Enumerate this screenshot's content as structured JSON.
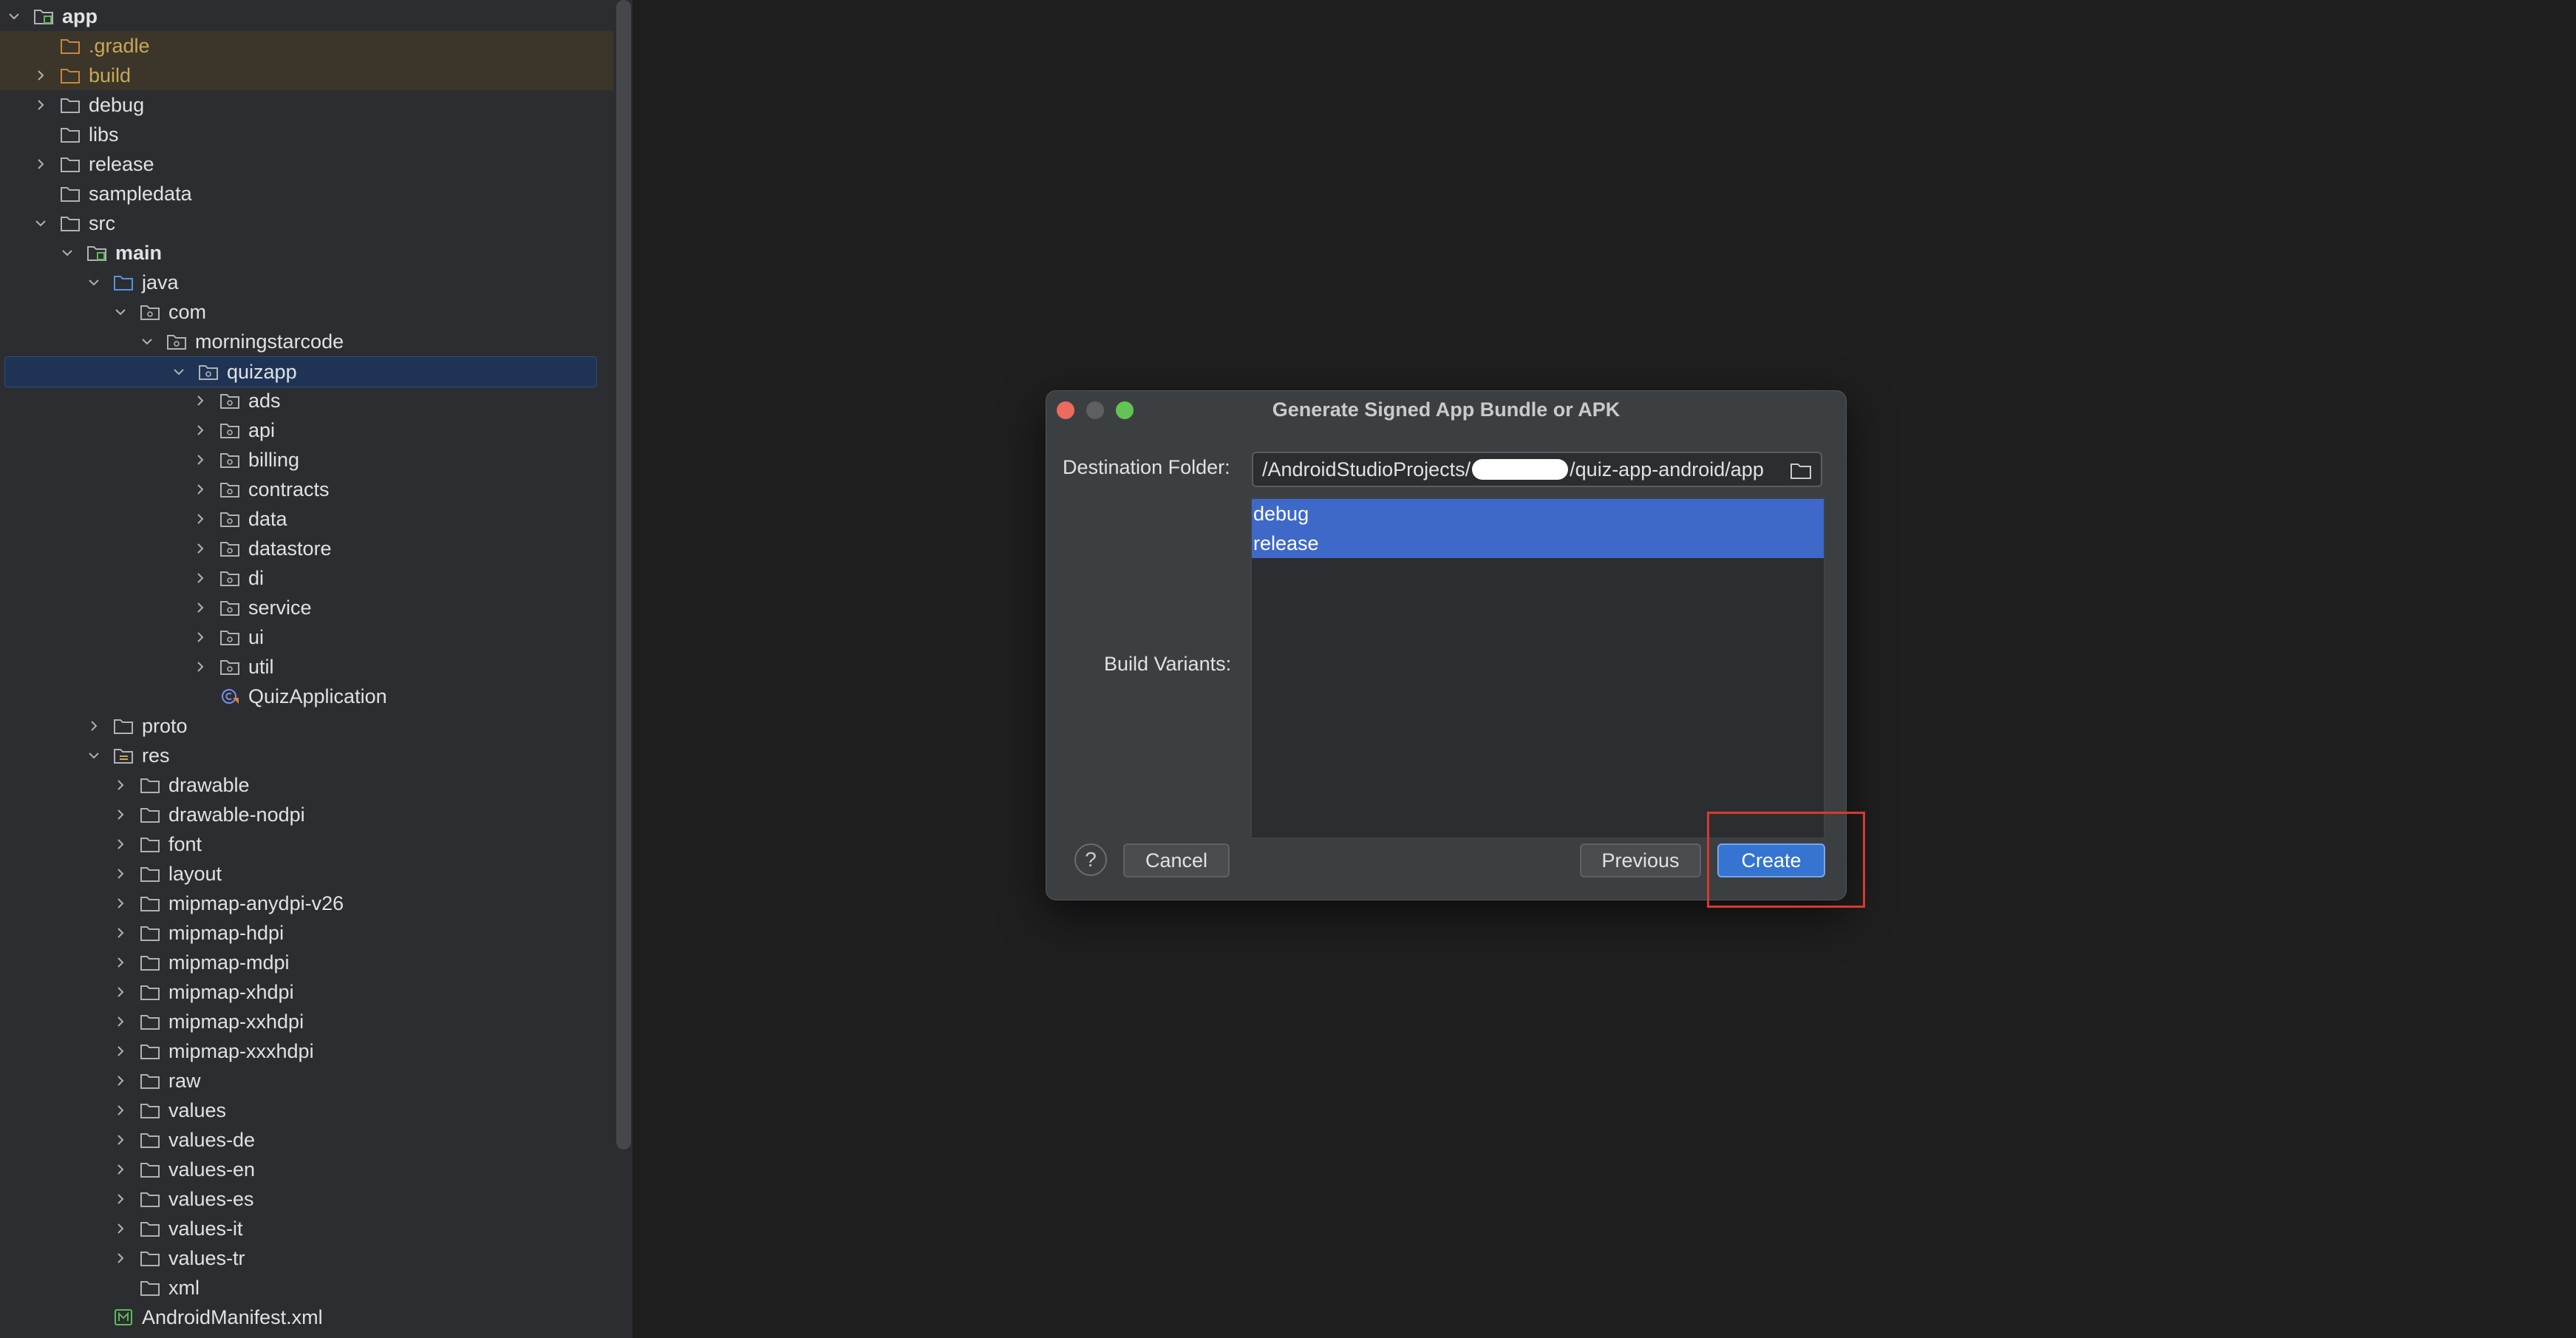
{
  "project_tree": {
    "rows": [
      {
        "label": "app",
        "expanded": true,
        "icon": "module-folder-icon",
        "bold": true
      },
      {
        "label": ".gradle",
        "icon": "excluded-folder-icon",
        "style": "excluded"
      },
      {
        "label": "build",
        "collapsed": true,
        "icon": "excluded-folder-icon",
        "style": "excluded"
      },
      {
        "label": "debug",
        "collapsed": true,
        "icon": "folder-icon"
      },
      {
        "label": "libs",
        "icon": "folder-icon"
      },
      {
        "label": "release",
        "collapsed": true,
        "icon": "folder-icon"
      },
      {
        "label": "sampledata",
        "icon": "folder-icon"
      },
      {
        "label": "src",
        "expanded": true,
        "icon": "folder-icon"
      },
      {
        "label": "main",
        "expanded": true,
        "icon": "module-folder-icon",
        "bold": true
      },
      {
        "label": "java",
        "expanded": true,
        "icon": "source-folder-icon"
      },
      {
        "label": "com",
        "expanded": true,
        "icon": "package-icon"
      },
      {
        "label": "morningstarcode",
        "expanded": true,
        "icon": "package-icon"
      },
      {
        "label": "quizapp",
        "expanded": true,
        "icon": "package-icon",
        "style": "selected"
      },
      {
        "label": "ads",
        "collapsed": true,
        "icon": "package-icon"
      },
      {
        "label": "api",
        "collapsed": true,
        "icon": "package-icon"
      },
      {
        "label": "billing",
        "collapsed": true,
        "icon": "package-icon"
      },
      {
        "label": "contracts",
        "collapsed": true,
        "icon": "package-icon"
      },
      {
        "label": "data",
        "collapsed": true,
        "icon": "package-icon"
      },
      {
        "label": "datastore",
        "collapsed": true,
        "icon": "package-icon"
      },
      {
        "label": "di",
        "collapsed": true,
        "icon": "package-icon"
      },
      {
        "label": "service",
        "collapsed": true,
        "icon": "package-icon"
      },
      {
        "label": "ui",
        "collapsed": true,
        "icon": "package-icon"
      },
      {
        "label": "util",
        "collapsed": true,
        "icon": "package-icon"
      },
      {
        "label": "QuizApplication",
        "icon": "kotlin-class-icon"
      },
      {
        "label": "proto",
        "collapsed": true,
        "icon": "folder-icon"
      },
      {
        "label": "res",
        "expanded": true,
        "icon": "resources-folder-icon"
      },
      {
        "label": "drawable",
        "collapsed": true,
        "icon": "folder-icon"
      },
      {
        "label": "drawable-nodpi",
        "collapsed": true,
        "icon": "folder-icon"
      },
      {
        "label": "font",
        "collapsed": true,
        "icon": "folder-icon"
      },
      {
        "label": "layout",
        "collapsed": true,
        "icon": "folder-icon"
      },
      {
        "label": "mipmap-anydpi-v26",
        "collapsed": true,
        "icon": "folder-icon"
      },
      {
        "label": "mipmap-hdpi",
        "collapsed": true,
        "icon": "folder-icon"
      },
      {
        "label": "mipmap-mdpi",
        "collapsed": true,
        "icon": "folder-icon"
      },
      {
        "label": "mipmap-xhdpi",
        "collapsed": true,
        "icon": "folder-icon"
      },
      {
        "label": "mipmap-xxhdpi",
        "collapsed": true,
        "icon": "folder-icon"
      },
      {
        "label": "mipmap-xxxhdpi",
        "collapsed": true,
        "icon": "folder-icon"
      },
      {
        "label": "raw",
        "collapsed": true,
        "icon": "folder-icon"
      },
      {
        "label": "values",
        "collapsed": true,
        "icon": "folder-icon"
      },
      {
        "label": "values-de",
        "collapsed": true,
        "icon": "folder-icon"
      },
      {
        "label": "values-en",
        "collapsed": true,
        "icon": "folder-icon"
      },
      {
        "label": "values-es",
        "collapsed": true,
        "icon": "folder-icon"
      },
      {
        "label": "values-it",
        "collapsed": true,
        "icon": "folder-icon"
      },
      {
        "label": "values-tr",
        "collapsed": true,
        "icon": "folder-icon"
      },
      {
        "label": "xml",
        "icon": "folder-icon"
      },
      {
        "label": "AndroidManifest.xml",
        "icon": "manifest-file-icon"
      }
    ]
  },
  "dialog": {
    "title": "Generate Signed App Bundle or APK",
    "destination_label": "Destination Folder:",
    "destination_prefix": "/AndroidStudioProjects/",
    "destination_suffix": "/quiz-app-android/app",
    "build_variants_label": "Build Variants:",
    "variants": [
      "debug",
      "release"
    ],
    "help_label": "?",
    "cancel_label": "Cancel",
    "previous_label": "Previous",
    "create_label": "Create"
  },
  "colors": {
    "annotation": "#d63a30",
    "selection": "#3e69c8",
    "primary_button": "#3574d0"
  }
}
